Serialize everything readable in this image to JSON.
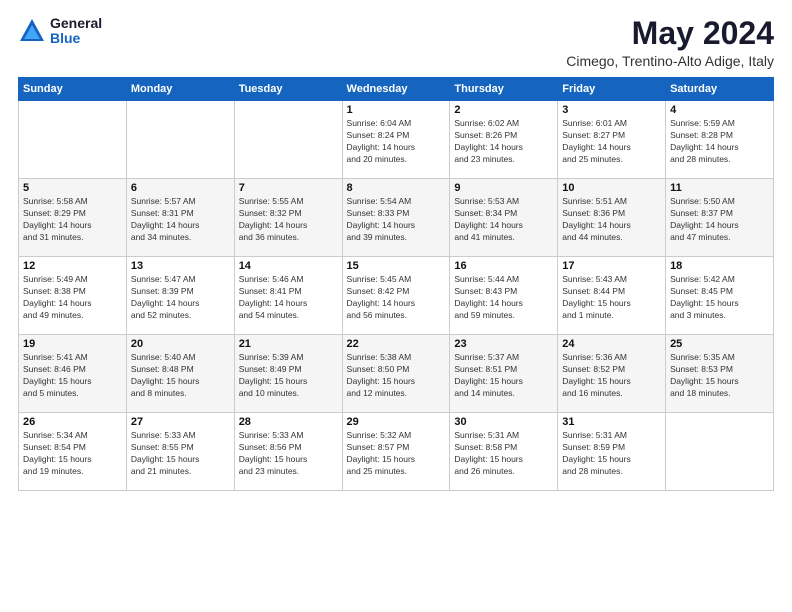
{
  "logo": {
    "general": "General",
    "blue": "Blue"
  },
  "title": "May 2024",
  "location": "Cimego, Trentino-Alto Adige, Italy",
  "days_of_week": [
    "Sunday",
    "Monday",
    "Tuesday",
    "Wednesday",
    "Thursday",
    "Friday",
    "Saturday"
  ],
  "weeks": [
    [
      {
        "day": "",
        "info": ""
      },
      {
        "day": "",
        "info": ""
      },
      {
        "day": "",
        "info": ""
      },
      {
        "day": "1",
        "info": "Sunrise: 6:04 AM\nSunset: 8:24 PM\nDaylight: 14 hours\nand 20 minutes."
      },
      {
        "day": "2",
        "info": "Sunrise: 6:02 AM\nSunset: 8:26 PM\nDaylight: 14 hours\nand 23 minutes."
      },
      {
        "day": "3",
        "info": "Sunrise: 6:01 AM\nSunset: 8:27 PM\nDaylight: 14 hours\nand 25 minutes."
      },
      {
        "day": "4",
        "info": "Sunrise: 5:59 AM\nSunset: 8:28 PM\nDaylight: 14 hours\nand 28 minutes."
      }
    ],
    [
      {
        "day": "5",
        "info": "Sunrise: 5:58 AM\nSunset: 8:29 PM\nDaylight: 14 hours\nand 31 minutes."
      },
      {
        "day": "6",
        "info": "Sunrise: 5:57 AM\nSunset: 8:31 PM\nDaylight: 14 hours\nand 34 minutes."
      },
      {
        "day": "7",
        "info": "Sunrise: 5:55 AM\nSunset: 8:32 PM\nDaylight: 14 hours\nand 36 minutes."
      },
      {
        "day": "8",
        "info": "Sunrise: 5:54 AM\nSunset: 8:33 PM\nDaylight: 14 hours\nand 39 minutes."
      },
      {
        "day": "9",
        "info": "Sunrise: 5:53 AM\nSunset: 8:34 PM\nDaylight: 14 hours\nand 41 minutes."
      },
      {
        "day": "10",
        "info": "Sunrise: 5:51 AM\nSunset: 8:36 PM\nDaylight: 14 hours\nand 44 minutes."
      },
      {
        "day": "11",
        "info": "Sunrise: 5:50 AM\nSunset: 8:37 PM\nDaylight: 14 hours\nand 47 minutes."
      }
    ],
    [
      {
        "day": "12",
        "info": "Sunrise: 5:49 AM\nSunset: 8:38 PM\nDaylight: 14 hours\nand 49 minutes."
      },
      {
        "day": "13",
        "info": "Sunrise: 5:47 AM\nSunset: 8:39 PM\nDaylight: 14 hours\nand 52 minutes."
      },
      {
        "day": "14",
        "info": "Sunrise: 5:46 AM\nSunset: 8:41 PM\nDaylight: 14 hours\nand 54 minutes."
      },
      {
        "day": "15",
        "info": "Sunrise: 5:45 AM\nSunset: 8:42 PM\nDaylight: 14 hours\nand 56 minutes."
      },
      {
        "day": "16",
        "info": "Sunrise: 5:44 AM\nSunset: 8:43 PM\nDaylight: 14 hours\nand 59 minutes."
      },
      {
        "day": "17",
        "info": "Sunrise: 5:43 AM\nSunset: 8:44 PM\nDaylight: 15 hours\nand 1 minute."
      },
      {
        "day": "18",
        "info": "Sunrise: 5:42 AM\nSunset: 8:45 PM\nDaylight: 15 hours\nand 3 minutes."
      }
    ],
    [
      {
        "day": "19",
        "info": "Sunrise: 5:41 AM\nSunset: 8:46 PM\nDaylight: 15 hours\nand 5 minutes."
      },
      {
        "day": "20",
        "info": "Sunrise: 5:40 AM\nSunset: 8:48 PM\nDaylight: 15 hours\nand 8 minutes."
      },
      {
        "day": "21",
        "info": "Sunrise: 5:39 AM\nSunset: 8:49 PM\nDaylight: 15 hours\nand 10 minutes."
      },
      {
        "day": "22",
        "info": "Sunrise: 5:38 AM\nSunset: 8:50 PM\nDaylight: 15 hours\nand 12 minutes."
      },
      {
        "day": "23",
        "info": "Sunrise: 5:37 AM\nSunset: 8:51 PM\nDaylight: 15 hours\nand 14 minutes."
      },
      {
        "day": "24",
        "info": "Sunrise: 5:36 AM\nSunset: 8:52 PM\nDaylight: 15 hours\nand 16 minutes."
      },
      {
        "day": "25",
        "info": "Sunrise: 5:35 AM\nSunset: 8:53 PM\nDaylight: 15 hours\nand 18 minutes."
      }
    ],
    [
      {
        "day": "26",
        "info": "Sunrise: 5:34 AM\nSunset: 8:54 PM\nDaylight: 15 hours\nand 19 minutes."
      },
      {
        "day": "27",
        "info": "Sunrise: 5:33 AM\nSunset: 8:55 PM\nDaylight: 15 hours\nand 21 minutes."
      },
      {
        "day": "28",
        "info": "Sunrise: 5:33 AM\nSunset: 8:56 PM\nDaylight: 15 hours\nand 23 minutes."
      },
      {
        "day": "29",
        "info": "Sunrise: 5:32 AM\nSunset: 8:57 PM\nDaylight: 15 hours\nand 25 minutes."
      },
      {
        "day": "30",
        "info": "Sunrise: 5:31 AM\nSunset: 8:58 PM\nDaylight: 15 hours\nand 26 minutes."
      },
      {
        "day": "31",
        "info": "Sunrise: 5:31 AM\nSunset: 8:59 PM\nDaylight: 15 hours\nand 28 minutes."
      },
      {
        "day": "",
        "info": ""
      }
    ]
  ]
}
